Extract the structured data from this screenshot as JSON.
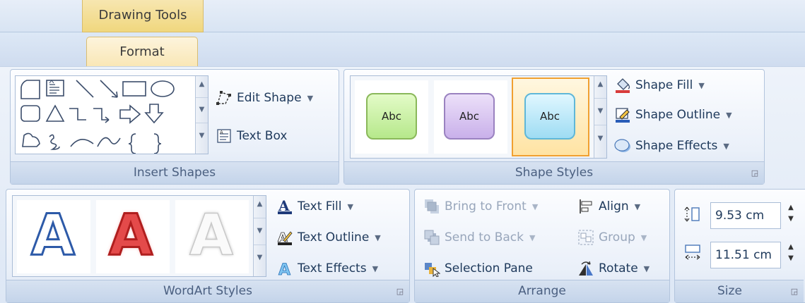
{
  "context": {
    "label": "Drawing Tools"
  },
  "tabs": [
    {
      "label": "Format",
      "active": true
    }
  ],
  "groups": {
    "insert_shapes": {
      "label": "Insert Shapes",
      "edit_shape": "Edit Shape",
      "text_box": "Text Box",
      "shapes": [
        "rounded-rectangle-corner",
        "text-box",
        "line",
        "arrow-line",
        "rectangle",
        "oval",
        "rounded-rectangle",
        "triangle",
        "elbow-connector",
        "elbow-arrow-connector",
        "right-arrow",
        "down-arrow",
        "freeform",
        "scribble",
        "arc",
        "curve",
        "left-brace",
        "right-brace"
      ]
    },
    "shape_styles": {
      "label": "Shape Styles",
      "samples": [
        {
          "text": "Abc",
          "fill": "#c8f09a",
          "border": "#8ab85a"
        },
        {
          "text": "Abc",
          "fill": "#d8c3ef",
          "border": "#9a82c0"
        },
        {
          "text": "Abc",
          "fill": "#bfeaf8",
          "border": "#5fb7d8"
        }
      ],
      "fill": "Shape Fill",
      "outline": "Shape Outline",
      "effects": "Shape Effects"
    },
    "wordart_styles": {
      "label": "WordArt Styles",
      "letters": [
        "A",
        "A",
        "A"
      ],
      "text_fill": "Text Fill",
      "text_outline": "Text Outline",
      "text_effects": "Text Effects"
    },
    "arrange": {
      "label": "Arrange",
      "bring_to_front": "Bring to Front",
      "send_to_back": "Send to Back",
      "selection_pane": "Selection Pane",
      "align": "Align",
      "group": "Group",
      "rotate": "Rotate"
    },
    "size": {
      "label": "Size",
      "height": "9.53 cm",
      "width": "11.51 cm"
    }
  },
  "colors": {
    "context_tab": "#f0d77e",
    "accent_selected": "#f7a21b"
  }
}
